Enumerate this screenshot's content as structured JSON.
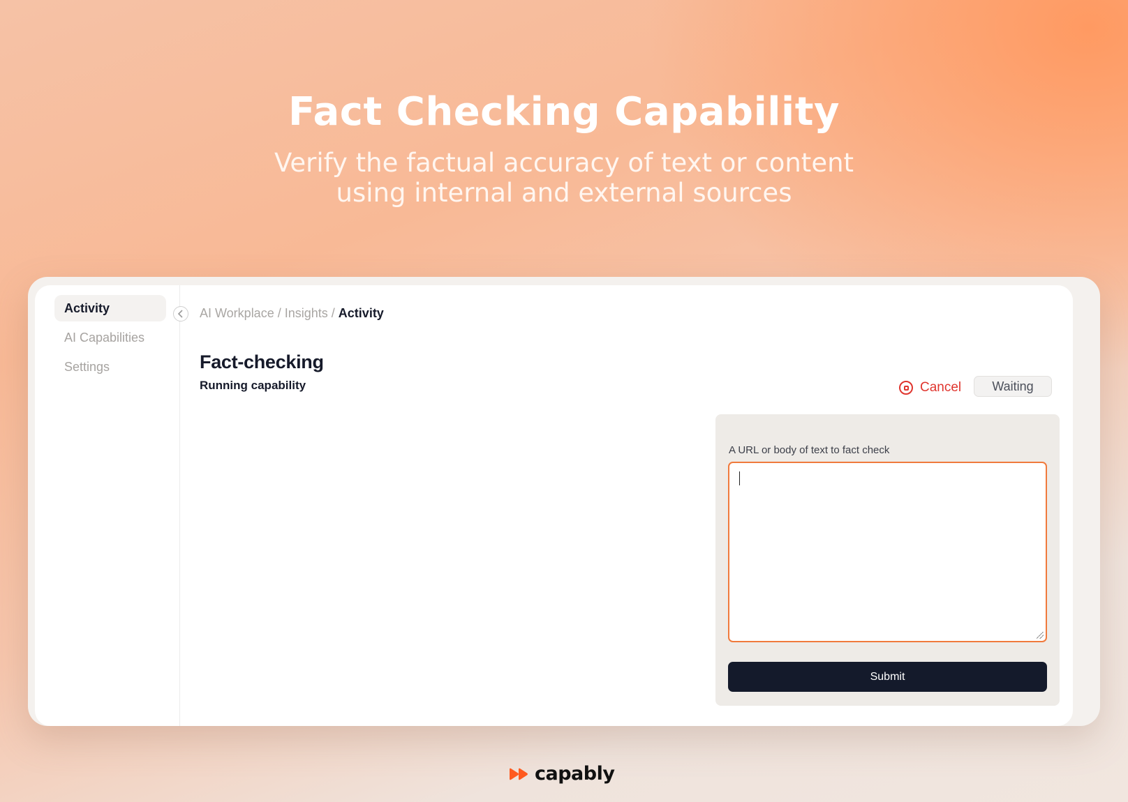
{
  "hero": {
    "title": "Fact Checking Capability",
    "subtitle_line1": "Verify the factual accuracy of text or content",
    "subtitle_line2": "using internal and external sources"
  },
  "sidebar": {
    "items": [
      {
        "label": "Activity",
        "active": true
      },
      {
        "label": "AI Capabilities",
        "active": false
      },
      {
        "label": "Settings",
        "active": false
      }
    ],
    "collapse_icon": "chevron-left-icon"
  },
  "breadcrumb": {
    "path": [
      "AI Workplace",
      "Insights"
    ],
    "separator": " / ",
    "current": "Activity"
  },
  "page": {
    "title": "Fact-checking",
    "subtitle": "Running capability"
  },
  "actions": {
    "cancel_label": "Cancel",
    "cancel_icon": "stop-circle-icon",
    "status": "Waiting"
  },
  "form": {
    "field_label": "A URL or body of text to fact check",
    "field_value": "",
    "submit_label": "Submit"
  },
  "footer": {
    "brand": "capably"
  },
  "colors": {
    "accent": "#f07a3c",
    "danger": "#e0352e",
    "dark": "#141a2b",
    "logo_mark": "#ff5a1f"
  }
}
